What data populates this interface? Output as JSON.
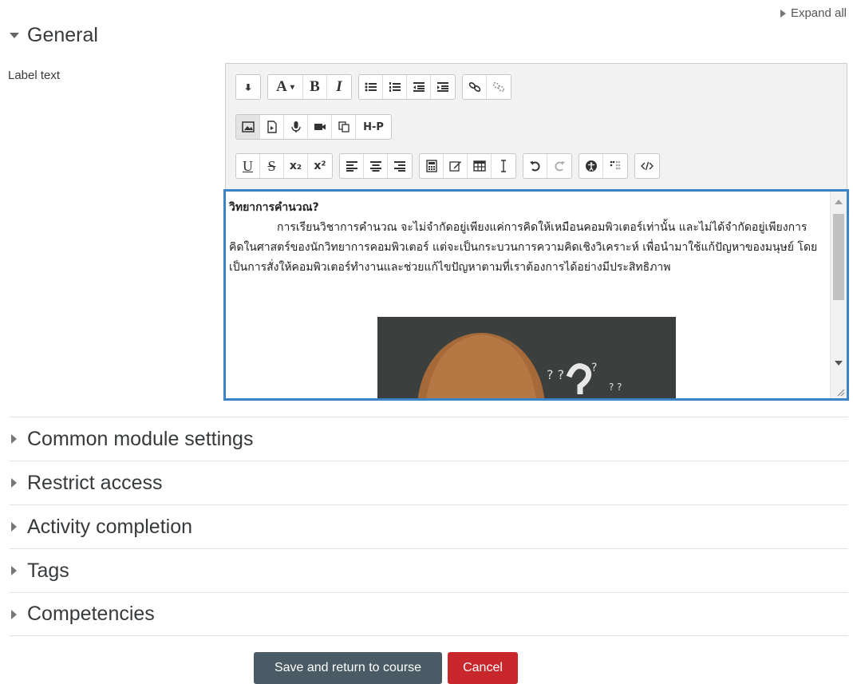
{
  "expand_all": "Expand all",
  "general": {
    "title": "General"
  },
  "label_text": "Label text",
  "editor": {
    "content": {
      "title": "วิทยาการคำนวณ?",
      "paragraph": "การเรียนวิชาการคำนวณ จะไม่จำกัดอยู่เพียงแค่การคิดให้เหมือนคอมพิวเตอร์เท่านั้น และไม่ได้จำกัดอยู่เพียงการคิดในศาสตร์ของนักวิทยาการคอมพิวเตอร์ แต่จะเป็นกระบวนการความคิดเชิงวิเคราะห์ เพื่อนำมาใช้แก้ปัญหาของมนุษย์ โดยเป็นการสั่งให้คอมพิวเตอร์ทำงานและช่วยแก้ไขปัญหาตามที่เราต้องการได้อย่างมีประสิทธิภาพ"
    },
    "toolbar": {
      "style_label": "A",
      "bold": "B",
      "italic": "I",
      "h5p": "H-P",
      "underline": "U",
      "strike": "S",
      "subscript": "x₂",
      "superscript": "x²"
    }
  },
  "sections": [
    {
      "title": "Common module settings"
    },
    {
      "title": "Restrict access"
    },
    {
      "title": "Activity completion"
    },
    {
      "title": "Tags"
    },
    {
      "title": "Competencies"
    }
  ],
  "buttons": {
    "save": "Save and return to course",
    "cancel": "Cancel"
  },
  "colors": {
    "focus_border": "#3a83c7",
    "save_bg": "#4a5b66",
    "cancel_bg": "#c8282c"
  }
}
